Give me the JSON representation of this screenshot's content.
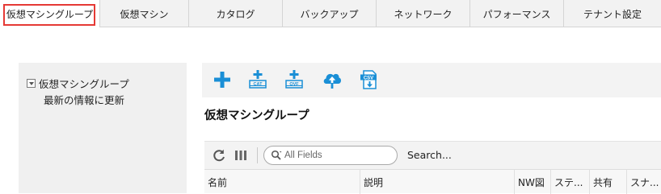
{
  "tabs": [
    {
      "label": "仮想マシングループ",
      "active": true
    },
    {
      "label": "仮想マシン"
    },
    {
      "label": "カタログ"
    },
    {
      "label": "バックアップ"
    },
    {
      "label": "ネットワーク"
    },
    {
      "label": "パフォーマンス"
    },
    {
      "label": "テナント設定"
    }
  ],
  "tree": {
    "root_label": "仮想マシングループ",
    "child_label": "最新の情報に更新"
  },
  "toolbar": {
    "icons": [
      "add-icon",
      "catalog-add-icon",
      "ovf-add-icon",
      "cloud-upload-icon",
      "csv-export-icon"
    ],
    "accent_color": "#1a8fd6",
    "cat_label": "CAT",
    "ovf_label": "OVF",
    "csv_label": "CSV"
  },
  "main": {
    "title": "仮想マシングループ"
  },
  "search": {
    "placeholder": "All Fields",
    "button_label": "Search..."
  },
  "table": {
    "columns": [
      "名前",
      "説明",
      "NW図",
      "ステ...",
      "共有",
      "スナ..."
    ]
  },
  "colors": {
    "active_tab_outline": "#e53935"
  }
}
